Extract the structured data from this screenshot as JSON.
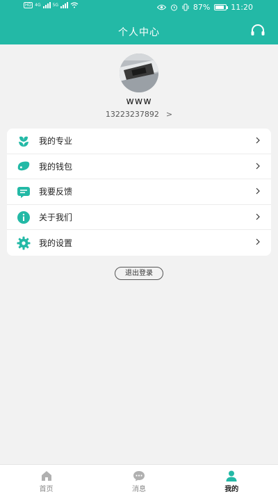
{
  "status_bar": {
    "hd1": "HD",
    "hd2": "HD",
    "net1": "4G",
    "net2": "5G",
    "battery_percent": "87%",
    "battery_level": 0.87,
    "time": "11:20"
  },
  "header": {
    "title": "个人中心"
  },
  "profile": {
    "username": "www",
    "phone": "13223237892",
    "chevron": ">"
  },
  "menu": {
    "items": [
      {
        "label": "我的专业",
        "icon": "flower-icon"
      },
      {
        "label": "我的钱包",
        "icon": "wallet-icon"
      },
      {
        "label": "我要反馈",
        "icon": "feedback-icon"
      },
      {
        "label": "关于我们",
        "icon": "info-icon"
      },
      {
        "label": "我的设置",
        "icon": "gear-icon"
      }
    ]
  },
  "logout_label": "退出登录",
  "tabbar": {
    "tabs": [
      {
        "label": "首页",
        "icon": "home-icon",
        "active": false
      },
      {
        "label": "消息",
        "icon": "message-icon",
        "active": false
      },
      {
        "label": "我的",
        "icon": "user-icon",
        "active": true
      }
    ]
  },
  "colors": {
    "accent": "#23b9a6",
    "background": "#f2f2f2",
    "tab_active": "#23b9a6",
    "tab_inactive": "#b0b0b0"
  }
}
